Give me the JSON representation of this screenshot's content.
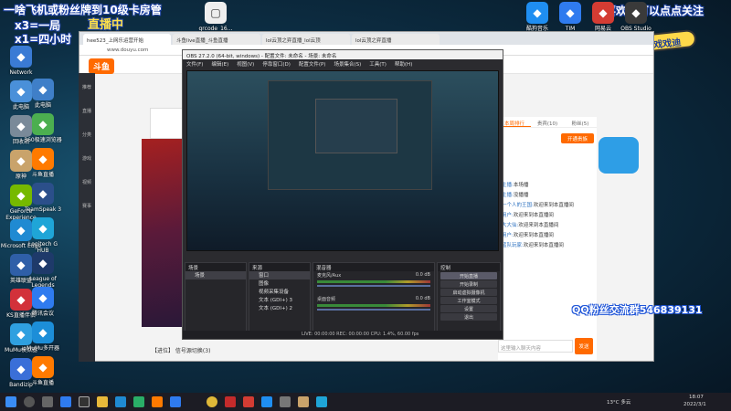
{
  "overlay": {
    "line1": "一啥飞机或粉丝牌到10级卡房管",
    "line2": "x3=一局",
    "line3": "x1=四小时",
    "live_label": "直播中",
    "top_right_caption": "喜欢的可以点点关注",
    "qq_group": "QQ粉丝交流群546839131",
    "banner": "戏戏迪"
  },
  "desktop_left": [
    {
      "label": "Network",
      "icon": "network-icon",
      "color": "#3a7bd5"
    },
    {
      "label": "此电脑",
      "icon": "computer-icon",
      "color": "#4a90d9"
    },
    {
      "label": "回收站",
      "icon": "recycle-bin-icon",
      "color": "#7a8a99"
    },
    {
      "label": "原神",
      "icon": "game-icon",
      "color": "#c9a36b"
    },
    {
      "label": "GeForce Experience",
      "icon": "nvidia-icon",
      "color": "#76b900"
    },
    {
      "label": "Microsoft Edge",
      "icon": "edge-icon",
      "color": "#1f8ad2"
    },
    {
      "label": "英雄联盟",
      "icon": "league-icon",
      "color": "#2f5fa8"
    },
    {
      "label": "KS直播伴侣",
      "icon": "ks-icon",
      "color": "#d2313a"
    },
    {
      "label": "MuMu模拟器",
      "icon": "mumu-icon",
      "color": "#2fa0e0"
    },
    {
      "label": "Bandizip",
      "icon": "bandizip-icon",
      "color": "#3a6fd8"
    }
  ],
  "desktop_col2": [
    {
      "label": "此电脑",
      "icon": "computer-icon",
      "color": "#3f7fc8"
    },
    {
      "label": "360极速浏览器",
      "icon": "browser-icon",
      "color": "#4caf50"
    },
    {
      "label": "斗鱼直播",
      "icon": "douyu-icon",
      "color": "#ff7a00"
    },
    {
      "label": "TeamSpeak 3",
      "icon": "teamspeak-icon",
      "color": "#2b4f8a"
    },
    {
      "label": "Logitech G HUB",
      "icon": "logitech-icon",
      "color": "#1fa5d7"
    },
    {
      "label": "League of Legends",
      "icon": "league-icon",
      "color": "#1e3a6a"
    },
    {
      "label": "腾讯会议",
      "icon": "meeting-icon",
      "color": "#2f7bef"
    },
    {
      "label": "MuMu多开器",
      "icon": "mumu-icon",
      "color": "#1c8ed8"
    },
    {
      "label": "斗鱼直播",
      "icon": "douyu-icon",
      "color": "#ff7a00"
    }
  ],
  "desktop_right": [
    {
      "label": "酷狗音乐",
      "icon": "kugou-icon",
      "color": "#1f8ef1"
    },
    {
      "label": "TIM",
      "icon": "tim-icon",
      "color": "#2f7bef"
    },
    {
      "label": "网易云",
      "icon": "music-icon",
      "color": "#d43c33"
    },
    {
      "label": "OBS Studio",
      "icon": "obs-icon",
      "color": "#3a3a3a"
    }
  ],
  "desktop_file": {
    "label": "qrcode_16...",
    "icon": "file-icon"
  },
  "browser": {
    "tabs": [
      {
        "label": "hee523_上网乐运营开始"
      },
      {
        "label": "斗鱼live直播_斗鱼直播"
      },
      {
        "label": "lol云顶之弈直播_lol云顶"
      },
      {
        "label": "lol云顶之弈直播"
      }
    ],
    "address": "www.douyu.com",
    "logo": "斗鱼",
    "nav": [
      "推荐",
      "直播",
      "分类",
      "游戏",
      "视频",
      "赛事"
    ],
    "streamer_bar": "【进位】  信号源切换(3)"
  },
  "chat": {
    "tabs": [
      "本周排行",
      "贵宾(10)",
      "粉丝(5)"
    ],
    "follow_button": "开通贵族",
    "messages": [
      {
        "user": "主播:",
        "text": "本场播"
      },
      {
        "user": "主播:",
        "text": "没播播"
      },
      {
        "user": "一个人的王国:",
        "text": "欢迎来到本直播间"
      },
      {
        "user": "用户:",
        "text": "欢迎来到本直播间"
      },
      {
        "user": "大大仙:",
        "text": "欢迎来到本直播间"
      },
      {
        "user": "用户:",
        "text": "欢迎来到本直播间"
      },
      {
        "user": "蓝队玩家:",
        "text": "欢迎来到本直播间"
      }
    ],
    "input_placeholder": "这里输入聊天内容",
    "send_label": "发送"
  },
  "obs": {
    "title": "OBS 27.2.0 (64-bit, windows) - 配置文件: 未命名 - 场景: 未命名",
    "menu": [
      "文件(F)",
      "编辑(E)",
      "视图(V)",
      "停靠窗口(D)",
      "配置文件(P)",
      "场景集合(S)",
      "工具(T)",
      "帮助(H)"
    ],
    "scenes_title": "场景",
    "sources_title": "来源",
    "mixer_title": "混音器",
    "controls_title": "控制",
    "sources": [
      "窗口",
      "图像",
      "视频采集设备",
      "文本 (GDI+) 3",
      "文本 (GDI+) 2"
    ],
    "mixer": [
      {
        "name": "麦克风/Aux",
        "level": "0.0 dB"
      },
      {
        "name": "桌面音频",
        "level": "0.0 dB"
      }
    ],
    "controls": [
      "开始直播",
      "开始录制",
      "启动虚拟摄像机",
      "工作室模式",
      "设置",
      "退出"
    ],
    "status": "LIVE: 00:00:00   REC: 00:00:00   CPU: 1.4%, 60.00 fps"
  },
  "tray": {
    "weather": "13°C 多云",
    "time": "18:07",
    "date": "2022/3/1"
  }
}
